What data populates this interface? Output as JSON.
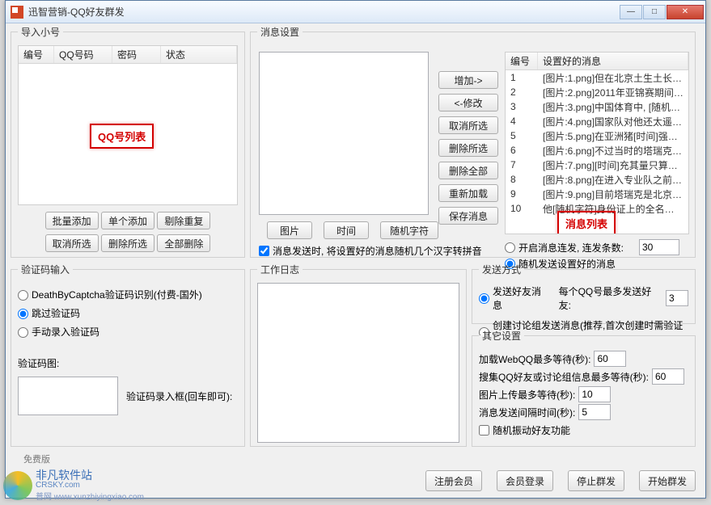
{
  "window": {
    "title": "迅智营销-QQ好友群发"
  },
  "import": {
    "legend": "导入小号",
    "cols": {
      "no": "编号",
      "qq": "QQ号码",
      "pw": "密码",
      "st": "状态"
    },
    "overlay": "QQ号列表",
    "btns": {
      "batch": "批量添加",
      "single": "单个添加",
      "dup": "剔除重复",
      "unsel": "取消所选",
      "delsel": "删除所选",
      "delall": "全部删除"
    }
  },
  "msgset": {
    "legend": "消息设置",
    "btns": {
      "add": "增加->",
      "mod": "<-修改",
      "cancelsel": "取消所选",
      "delsel": "删除所选",
      "delall": "删除全部",
      "reload": "重新加载",
      "save": "保存消息",
      "pic": "图片",
      "time": "时间",
      "rand": "随机字符"
    },
    "cols": {
      "no": "编号",
      "body": "设置好的消息"
    },
    "rows": [
      {
        "n": "1",
        "t": "[图片:1.png]但在北京土生土长…"
      },
      {
        "n": "2",
        "t": "[图片:2.png]2011年亚锦赛期间,…"
      },
      {
        "n": "3",
        "t": "[图片:3.png]中国体育中, [随机…"
      },
      {
        "n": "4",
        "t": "[图片:4.png]国家队对他还太遥…"
      },
      {
        "n": "5",
        "t": "[图片:5.png]在亚洲猪[时间]强…"
      },
      {
        "n": "6",
        "t": "[图片:6.png]不过当时的塔瑞克…"
      },
      {
        "n": "7",
        "t": "[图片:7.png][时间]充其量只算…"
      },
      {
        "n": "8",
        "t": "[图片:8.png]在进入专业队之前…"
      },
      {
        "n": "9",
        "t": "[图片:9.png]目前塔瑞克是北京…"
      },
      {
        "n": "10",
        "t": "他[随机字符]身份证上的全名是…"
      }
    ],
    "overlay": "消息列表",
    "opt_continuous": "开启消息连发, 连发条数:",
    "opt_continuous_val": "30",
    "opt_random": "随机发送设置好的消息",
    "chk_convert": "消息发送时, 将设置好的消息随机几个汉字转拼音"
  },
  "captcha": {
    "legend": "验证码输入",
    "r1": "DeathByCaptcha验证码识别(付费-国外)",
    "r2": "跳过验证码",
    "r3": "手动录入验证码",
    "imglabel": "验证码图:",
    "hint": "验证码录入框(回车即可):"
  },
  "log": {
    "legend": "工作日志"
  },
  "sendmode": {
    "legend": "发送方式",
    "r1": "发送好友消息",
    "r1_tail": "每个QQ号最多发送好友:",
    "r1_val": "3",
    "r2": "创建讨论组发送消息(推荐,首次创建时需验证码)"
  },
  "other": {
    "legend": "其它设置",
    "l1": "加载WebQQ最多等待(秒):",
    "v1": "60",
    "l2": "搜集QQ好友或讨论组信息最多等待(秒):",
    "v2": "60",
    "l3": "图片上传最多等待(秒):",
    "v3": "10",
    "l4": "消息发送间隔时间(秒):",
    "v4": "5",
    "chk": "随机振动好友功能"
  },
  "footer": {
    "reg": "注册会员",
    "login": "会员登录",
    "stop": "停止群发",
    "start": "开始群发"
  },
  "free": "免费版",
  "wm": {
    "main": "非凡软件站",
    "sub": "CRSKY.com",
    "link": "普网 www.xunzhiyingxiao.com"
  }
}
